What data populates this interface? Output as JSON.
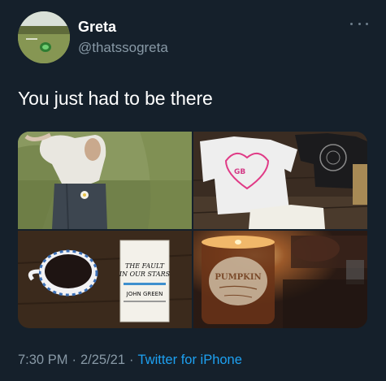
{
  "user": {
    "display_name": "Greta",
    "handle": "@thatssogreta",
    "avatar_icon": "profile-photo-grass-field"
  },
  "more_icon": "ellipsis-icon",
  "tweet": {
    "text": "You just had to be there"
  },
  "media": [
    {
      "name": "photo-outfit-on-grass",
      "description_icon": "photo"
    },
    {
      "name": "photo-tshirts-on-floor",
      "description_icon": "photo"
    },
    {
      "name": "photo-coffee-and-book",
      "description_icon": "photo"
    },
    {
      "name": "photo-pumpkin-candle",
      "description_icon": "photo"
    }
  ],
  "book": {
    "title_line1": "THE FAULT",
    "title_line2": "IN OUR STARS",
    "author": "JOHN GREEN"
  },
  "candle": {
    "label_line1": "PUMPKIN"
  },
  "footer": {
    "time": "7:30 PM",
    "date": "2/25/21",
    "separator": "·",
    "source": "Twitter for iPhone"
  },
  "colors": {
    "background": "#15202b",
    "primary_text": "#ffffff",
    "secondary_text": "#8899a6",
    "link": "#1da1f2"
  }
}
